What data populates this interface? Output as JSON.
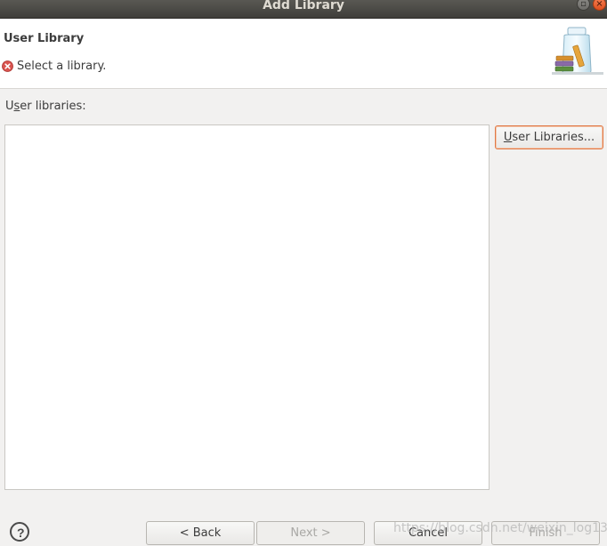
{
  "window": {
    "title": "Add Library"
  },
  "header": {
    "heading": "User Library",
    "message": "Select a library.",
    "message_icon": "error-icon"
  },
  "body": {
    "list_label_pre": "U",
    "list_label_mnemonic": "s",
    "list_label_post": "er libraries:",
    "list_items": [],
    "user_libraries_button_mnemonic": "U",
    "user_libraries_button_rest": "ser Libraries..."
  },
  "footer": {
    "help_label": "?",
    "back_label": "< Back",
    "back_mnemonic": "B",
    "next_label": "Next >",
    "cancel_label": "Cancel",
    "finish_label": "Finish"
  },
  "watermark": "https://blog.csdn.net/weixin_log13",
  "colors": {
    "focus_border": "#e07845",
    "error_icon": "#d9534f"
  }
}
